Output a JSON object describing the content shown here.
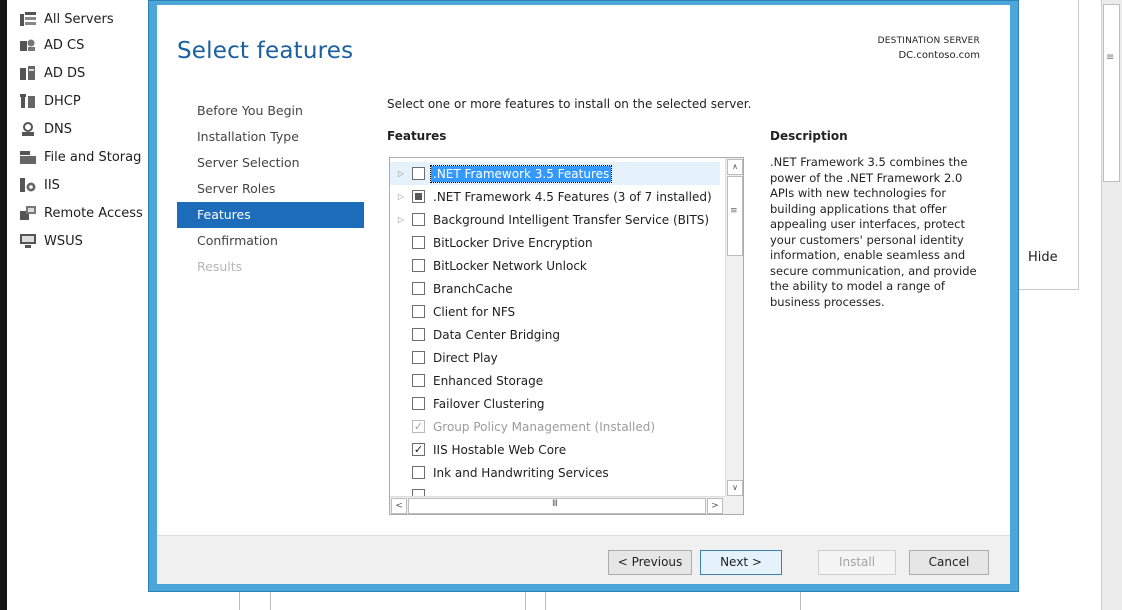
{
  "server_manager": {
    "nav_items": [
      {
        "label": "All Servers",
        "icon": "all-servers-icon"
      },
      {
        "label": "AD CS",
        "icon": "ad-cs-icon"
      },
      {
        "label": "AD DS",
        "icon": "ad-ds-icon"
      },
      {
        "label": "DHCP",
        "icon": "dhcp-icon"
      },
      {
        "label": "DNS",
        "icon": "dns-icon"
      },
      {
        "label": "File and Storag",
        "icon": "file-storage-icon"
      },
      {
        "label": "IIS",
        "icon": "iis-icon"
      },
      {
        "label": "Remote Access",
        "icon": "remote-access-icon"
      },
      {
        "label": "WSUS",
        "icon": "wsus-icon"
      }
    ],
    "hide_label": "Hide"
  },
  "wizard": {
    "title": "Select features",
    "destination_label": "DESTINATION SERVER",
    "destination_server": "DC.contoso.com",
    "steps": [
      {
        "label": "Before You Begin",
        "state": "normal"
      },
      {
        "label": "Installation Type",
        "state": "normal"
      },
      {
        "label": "Server Selection",
        "state": "normal"
      },
      {
        "label": "Server Roles",
        "state": "normal"
      },
      {
        "label": "Features",
        "state": "active"
      },
      {
        "label": "Confirmation",
        "state": "normal"
      },
      {
        "label": "Results",
        "state": "disabled"
      }
    ],
    "instructions": "Select one or more features to install on the selected server.",
    "features_heading": "Features",
    "features": [
      {
        "label": ".NET Framework 3.5 Features",
        "expandable": true,
        "check": "unchecked",
        "selected": true
      },
      {
        "label": ".NET Framework 4.5 Features (3 of 7 installed)",
        "expandable": true,
        "check": "partial"
      },
      {
        "label": "Background Intelligent Transfer Service (BITS)",
        "expandable": true,
        "check": "unchecked"
      },
      {
        "label": "BitLocker Drive Encryption",
        "check": "unchecked"
      },
      {
        "label": "BitLocker Network Unlock",
        "check": "unchecked"
      },
      {
        "label": "BranchCache",
        "check": "unchecked"
      },
      {
        "label": "Client for NFS",
        "check": "unchecked"
      },
      {
        "label": "Data Center Bridging",
        "check": "unchecked"
      },
      {
        "label": "Direct Play",
        "check": "unchecked"
      },
      {
        "label": "Enhanced Storage",
        "check": "unchecked"
      },
      {
        "label": "Failover Clustering",
        "check": "unchecked"
      },
      {
        "label": "Group Policy Management (Installed)",
        "check": "checked-disabled"
      },
      {
        "label": "IIS Hostable Web Core",
        "check": "checked"
      },
      {
        "label": "Ink and Handwriting Services",
        "check": "unchecked"
      }
    ],
    "description_heading": "Description",
    "description_text": ".NET Framework 3.5 combines the power of the .NET Framework 2.0 APIs with new technologies for building applications that offer appealing user interfaces, protect your customers' personal identity information, enable seamless and secure communication, and provide the ability to model a range of business processes.",
    "buttons": {
      "previous": "< Previous",
      "next": "Next >",
      "install": "Install",
      "cancel": "Cancel"
    }
  },
  "colors": {
    "frame_blue": "#4ca6d8",
    "title_blue": "#1a5fa0",
    "active_step": "#1c6cba",
    "selection": "#3399ff"
  }
}
